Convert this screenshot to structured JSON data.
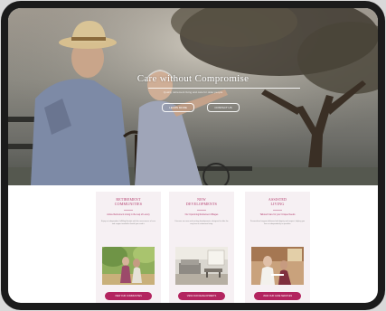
{
  "hero": {
    "title": "Care without Compromise",
    "subtitle": "Quality retirement living and care for older people",
    "buttons": [
      "LEARN MORE",
      "CONTACT US"
    ]
  },
  "cards": [
    {
      "title": "RETIREMENT\nCOMMUNITIES",
      "lead": "Active Retirement Living in the Lap of Luxury",
      "body": "Enjoy an independent, fulfilling lifestyle with the reassurance of care and support available should you need it.",
      "button": "VIEW OUR COMMUNITIES"
    },
    {
      "title": "NEW\nDEVELOPMENTS",
      "lead": "Our Upcoming Retirement Villages",
      "body": "Discover our new and exciting developments, designed to offer the very best in retirement living.",
      "button": "VIEW OUR DEVELOPMENTS"
    },
    {
      "title": "ASSISTED\nLIVING",
      "lead": "Tailored Care for your Unique Needs",
      "body": "Personalised support delivered with dignity and respect, helping you live as independently as possible.",
      "button": "VIEW OUR CARE SERVICES"
    }
  ],
  "colors": {
    "accent": "#b3245f",
    "card_background": "#f6f0f3",
    "device_frame": "#1b1b1b"
  }
}
